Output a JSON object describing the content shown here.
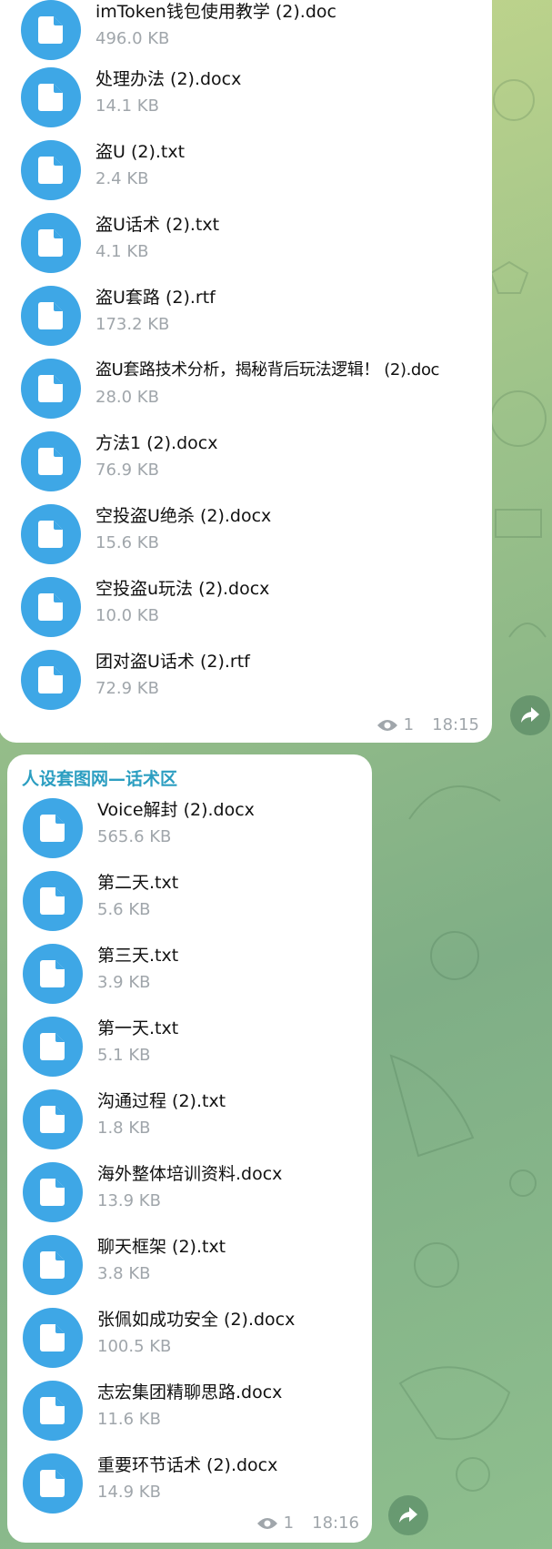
{
  "messages": [
    {
      "sender": "",
      "views": "1",
      "time": "18:15",
      "files": [
        {
          "name": "imToken钱包使用教学 (2).doc",
          "size": "496.0 KB"
        },
        {
          "name": "处理办法 (2).docx",
          "size": "14.1 KB"
        },
        {
          "name": "盗U (2).txt",
          "size": "2.4 KB"
        },
        {
          "name": "盗U话术 (2).txt",
          "size": "4.1 KB"
        },
        {
          "name": "盗U套路 (2).rtf",
          "size": "173.2 KB"
        },
        {
          "name": "盗U套路技术分析，揭秘背后玩法逻辑！ (2).doc",
          "size": "28.0 KB"
        },
        {
          "name": "方法1 (2).docx",
          "size": "76.9 KB"
        },
        {
          "name": "空投盗U绝杀 (2).docx",
          "size": "15.6 KB"
        },
        {
          "name": "空投盗u玩法 (2).docx",
          "size": "10.0 KB"
        },
        {
          "name": "团对盗U话术 (2).rtf",
          "size": "72.9 KB"
        }
      ]
    },
    {
      "sender": "人设套图网—话术区",
      "views": "1",
      "time": "18:16",
      "files": [
        {
          "name": "Voice解封 (2).docx",
          "size": "565.6 KB"
        },
        {
          "name": "第二天.txt",
          "size": "5.6 KB"
        },
        {
          "name": "第三天.txt",
          "size": "3.9 KB"
        },
        {
          "name": "第一天.txt",
          "size": "5.1 KB"
        },
        {
          "name": "沟通过程 (2).txt",
          "size": "1.8 KB"
        },
        {
          "name": "海外整体培训资料.docx",
          "size": "13.9 KB"
        },
        {
          "name": "聊天框架 (2).txt",
          "size": "3.8 KB"
        },
        {
          "name": "张佩如成功安全 (2).docx",
          "size": "100.5 KB"
        },
        {
          "name": "志宏集团精聊思路.docx",
          "size": "11.6 KB"
        },
        {
          "name": "重要环节话术 (2).docx",
          "size": "14.9 KB"
        }
      ]
    }
  ],
  "icons": {
    "file": "document-icon",
    "views": "eye-icon",
    "forward": "share-arrow-icon"
  },
  "colors": {
    "accent": "#3ea7e6",
    "sender": "#2c9ec1",
    "meta": "#a0a6ab"
  }
}
